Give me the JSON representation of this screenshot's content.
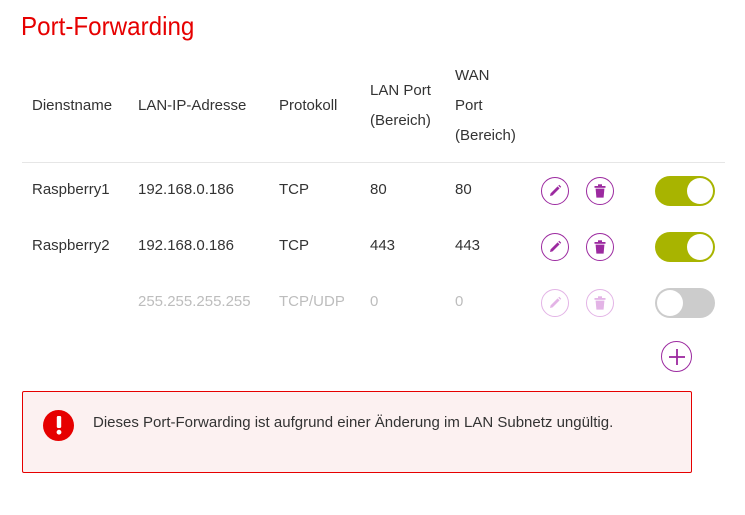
{
  "page": {
    "title": "Port-Forwarding"
  },
  "table": {
    "headers": {
      "service_name": "Dienstname",
      "lan_ip": "LAN-IP-Adresse",
      "protocol": "Protokoll",
      "lan_port_line1": "LAN Port",
      "lan_port_line2": "(Bereich)",
      "wan_port_line1": "WAN",
      "wan_port_line2": "Port",
      "wan_port_line3": "(Bereich)"
    },
    "rows": [
      {
        "service_name": "Raspberry1",
        "lan_ip": "192.168.0.186",
        "protocol": "TCP",
        "lan_port": "80",
        "wan_port": "80",
        "enabled": true
      },
      {
        "service_name": "Raspberry2",
        "lan_ip": "192.168.0.186",
        "protocol": "TCP",
        "lan_port": "443",
        "wan_port": "443",
        "enabled": true
      }
    ],
    "new_row": {
      "lan_ip_placeholder": "255.255.255.255",
      "protocol_placeholder": "TCP/UDP",
      "lan_port_placeholder": "0",
      "wan_port_placeholder": "0",
      "enabled": false
    }
  },
  "icons": {
    "edit": "pencil-icon",
    "delete": "trash-icon",
    "add": "plus-icon",
    "alert": "exclamation-icon"
  },
  "alert": {
    "message": "Dieses Port-Forwarding ist aufgrund einer Änderung im LAN Subnetz ungültig."
  },
  "colors": {
    "brand_red": "#e60000",
    "action_purple": "#9c2aa0",
    "toggle_on": "#a8b400",
    "toggle_off": "#cccccc",
    "alert_background": "#fcf1f1",
    "muted_text": "#bdbdbd"
  }
}
